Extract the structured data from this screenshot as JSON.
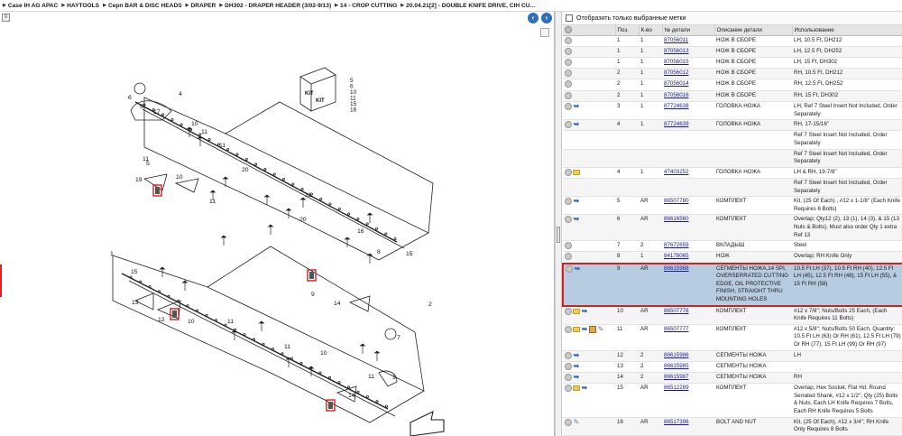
{
  "breadcrumb": [
    "Case IH AG APAC",
    "HAYTOOLS",
    "Серп BAR & DISC HEADS",
    "DRAPER",
    "DH302 - DRAPER HEADER (3/02-9/13)",
    "14 - CROP CUTTING",
    "20.04.21[2] - DOUBLE KNIFE DRIVE, CIH CU..."
  ],
  "filter": {
    "label": "Отобразить только выбранные метки",
    "checked": false
  },
  "columns": [
    "",
    "Поз.",
    "К-во",
    "№ детали",
    "Описание детали",
    "Использование"
  ],
  "rows": [
    {
      "icons": [
        "circle"
      ],
      "pos": "1",
      "qty": "1",
      "pn": "87056011",
      "desc": "НОЖ В СБОРЕ",
      "usage": "LH, 10.5 Ft, DH212"
    },
    {
      "icons": [
        "circle"
      ],
      "pos": "1",
      "qty": "1",
      "pn": "87056013",
      "desc": "НОЖ В СБОРЕ",
      "usage": "LH, 12.5 Ft, DH252"
    },
    {
      "icons": [
        "circle"
      ],
      "pos": "1",
      "qty": "1",
      "pn": "87056015",
      "desc": "НОЖ В СБОРЕ",
      "usage": "LH, 15 Ft, DH302"
    },
    {
      "icons": [
        "circle"
      ],
      "pos": "2",
      "qty": "1",
      "pn": "87056012",
      "desc": "НОЖ В СБОРЕ",
      "usage": "RH, 10.5 Ft, DH212"
    },
    {
      "icons": [
        "circle"
      ],
      "pos": "2",
      "qty": "1",
      "pn": "87056014",
      "desc": "НОЖ В СБОРЕ",
      "usage": "RH, 12.5 Ft, DH252"
    },
    {
      "icons": [
        "circle"
      ],
      "pos": "2",
      "qty": "1",
      "pn": "87056016",
      "desc": "НОЖ В СБОРЕ",
      "usage": "RH, 15 Ft, DH302"
    },
    {
      "icons": [
        "circle",
        "arrow"
      ],
      "pos": "3",
      "qty": "1",
      "pn": "87724638",
      "desc": "ГОЛОВКА НОЖА",
      "usage": "LH, Ref 7 Steel Insert Not Included, Order Separately"
    },
    {
      "icons": [
        "circle",
        "arrow"
      ],
      "pos": "4",
      "qty": "1",
      "pn": "87724639",
      "desc": "ГОЛОВКА НОЖА",
      "usage": "RH, 17-15/16''"
    },
    {
      "icons": [],
      "pos": "",
      "qty": "",
      "pn": "",
      "desc": "",
      "usage": "Ref 7 Steel Insert Not Included, Order Separately"
    },
    {
      "icons": [],
      "pos": "",
      "qty": "",
      "pn": "",
      "desc": "",
      "usage": "Ref 7 Steel Insert Not Included, Order Separately"
    },
    {
      "icons": [
        "circle",
        "folder"
      ],
      "pos": "4",
      "qty": "1",
      "pn": "47403252",
      "desc": "ГОЛОВКА НОЖА",
      "usage": "LH & RH, 19-7/8''"
    },
    {
      "icons": [],
      "pos": "",
      "qty": "",
      "pn": "",
      "desc": "",
      "usage": "Ref 7 Steel Insert Not Included, Order Separately"
    },
    {
      "icons": [
        "circle",
        "arrow"
      ],
      "pos": "5",
      "qty": "AR",
      "pn": "86507780",
      "desc": "КОМПЛЕКТ",
      "usage": "Kit, (25 Of Each) , #12 x 1-1/8'' (Each Knife Requires 6 Bolts)"
    },
    {
      "icons": [
        "circle",
        "arrow"
      ],
      "pos": "6",
      "qty": "AR",
      "pn": "86616560",
      "desc": "КОМПЛЕКТ",
      "usage": "Overlap; Qty12 (2), 13 (1), 14 (3), & 15 (13 Nuts & Bolts), Must also order Qty 1 extra Ref 13"
    },
    {
      "icons": [
        "circle"
      ],
      "pos": "7",
      "qty": "2",
      "pn": "87672659",
      "desc": "ВКЛАДЫШ",
      "usage": "Steel"
    },
    {
      "icons": [
        "circle"
      ],
      "pos": "8",
      "qty": "1",
      "pn": "84178065",
      "desc": "НОЖ",
      "usage": "Overlap; RH Knife Only"
    },
    {
      "icons": [
        "circle",
        "arrow"
      ],
      "pos": "9",
      "qty": "AR",
      "pn": "86615988",
      "desc": "СЕГМЕНТЫ НОЖА,14 SPI, OVERSERRATED CUTTING EDGE, OIL PROTECTIVE FINISH, STRAIGHT THRU MOUNTING HOLES",
      "usage": "10.5 Ft LH (37), 10.5 Ft RH (40), 12.5 Ft LH (45), 12.5 Ft RH (48), 15 Ft LH (55), & 15 Ft RH (58)",
      "highlight": true
    },
    {
      "icons": [
        "circle",
        "folder",
        "arrow"
      ],
      "pos": "10",
      "qty": "AR",
      "pn": "86507778",
      "desc": "КОМПЛЕКТ",
      "usage": "#12 x 7/8''; Nuts/Bolts 25 Each, (Each Knife Requires 11 Bolts)"
    },
    {
      "icons": [
        "circle",
        "folder",
        "arrow",
        "box",
        "wrench"
      ],
      "pos": "11",
      "qty": "AR",
      "pn": "86507777",
      "desc": "КОМПЛЕКТ",
      "usage": "#12 x 5/8''; Nuts/Bolts 50 Each, Quantity: 10.5 Ft LH (63) Or RH (61), 12.5 Ft LH (79) Or RH (77), 15 Ft LH (99) Or RH (97)"
    },
    {
      "icons": [
        "circle",
        "arrow"
      ],
      "pos": "12",
      "qty": "2",
      "pn": "86615986",
      "desc": "СЕГМЕНТЫ НОЖА",
      "usage": "LH"
    },
    {
      "icons": [
        "circle",
        "arrow"
      ],
      "pos": "13",
      "qty": "2",
      "pn": "86615985",
      "desc": "СЕГМЕНТЫ НОЖА",
      "usage": ""
    },
    {
      "icons": [
        "circle",
        "arrow"
      ],
      "pos": "14",
      "qty": "2",
      "pn": "86615987",
      "desc": "СЕГМЕНТЫ НОЖА",
      "usage": "RH"
    },
    {
      "icons": [
        "circle",
        "folder",
        "arrow"
      ],
      "pos": "15",
      "qty": "AR",
      "pn": "86512289",
      "desc": "КОМПЛЕКТ",
      "usage": "Overlap, Hex Socket, Flat Hd, Round Serrated Shank, #12 x 1/2''; Qty (25) Bolts & Nuts. Each LH Knife Requires 7 Bolts, Each RH Knife Requires 5 Bolts"
    },
    {
      "icons": [
        "circle",
        "wrench"
      ],
      "pos": "16",
      "qty": "AR",
      "pn": "86517396",
      "desc": "BOLT AND NUT",
      "usage": "Kit, (25 Of Each), #12 x 3/4''; RH Knife Only Requires 8 Bolts"
    }
  ],
  "diagram": {
    "callouts": [
      "1",
      "2",
      "3",
      "4",
      "5",
      "6",
      "7",
      "8",
      "9",
      "10",
      "11",
      "12",
      "13",
      "14",
      "15",
      "16",
      "17",
      "19",
      "20"
    ],
    "kit_labels": [
      "KIT",
      "KIT"
    ],
    "kit_list": [
      "5",
      "6",
      "10",
      "11",
      "15",
      "16"
    ]
  },
  "colors": {
    "highlight_row": "#b7cce0",
    "highlight_border": "#d61f1f",
    "link": "#1a1aa6",
    "nav_button": "#2f6fb8"
  }
}
